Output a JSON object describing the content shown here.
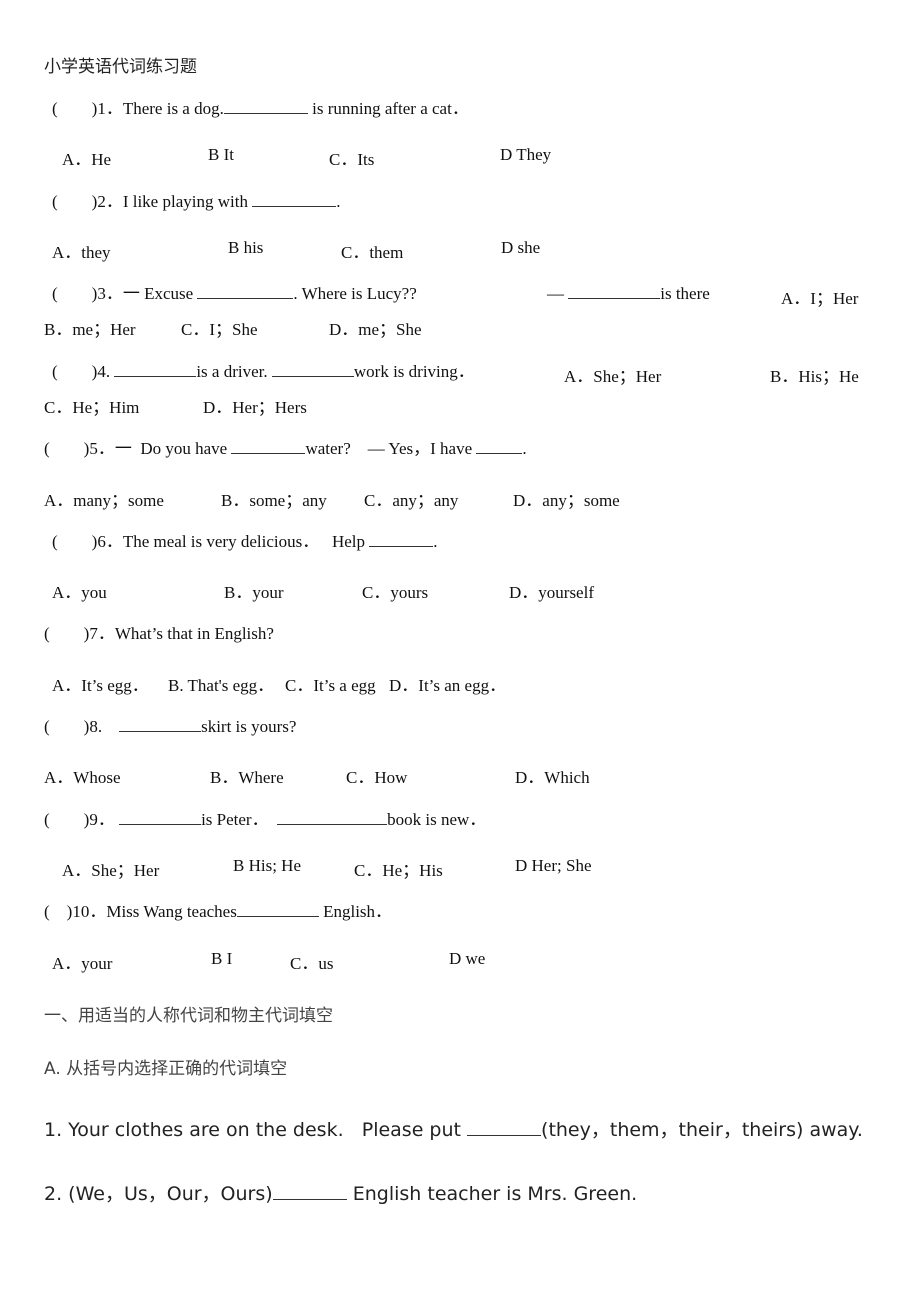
{
  "document": {
    "title": "小学英语代词练习题",
    "questions": [
      {
        "number": "1",
        "prefix": "(        )1．",
        "parts": [
          "There is a dog.",
          " is running after a cat．"
        ],
        "options": [
          "A．He",
          "B It",
          "C．Its",
          "D They"
        ]
      },
      {
        "number": "2",
        "prefix": "(        )2．",
        "parts": [
          "I like playing with ",
          "."
        ],
        "options": [
          "A．they",
          "B his",
          "C．them",
          "D she"
        ]
      },
      {
        "number": "3",
        "prefix": "(        )3．",
        "parts": [
          "一 Excuse ",
          ". Where is Lucy??",
          "— ",
          "is there"
        ],
        "options": [
          "A．I；Her",
          "B．me；Her",
          "C．I；She",
          "D．me；She"
        ]
      },
      {
        "number": "4",
        "prefix": "(        )4.",
        "parts": [
          " ",
          "is a driver. ",
          "work is driving．"
        ],
        "options": [
          "A．She；Her",
          "B．His；He",
          "C．He；Him",
          "D．Her；Hers"
        ]
      },
      {
        "number": "5",
        "prefix": "(        )5．",
        "parts": [
          "一  Do you have ",
          "water?",
          "— Yes，I have ",
          "."
        ],
        "options": [
          "A．many；some",
          "B．some；any",
          "C．any；any",
          "D．any；some"
        ]
      },
      {
        "number": "6",
        "prefix": "(        )6．",
        "parts": [
          "The meal is very delicious．   Help ",
          "."
        ],
        "options": [
          "A．you",
          "B．your",
          "C．yours",
          "D．yourself"
        ]
      },
      {
        "number": "7",
        "prefix": "(        )7．",
        "parts": [
          "What’s that in English?"
        ],
        "options": [
          "A．It’s egg．",
          "B. That's egg．",
          "C．It’s a egg",
          "D．It’s an egg．"
        ]
      },
      {
        "number": "8",
        "prefix": "(        )8.",
        "parts": [
          "skirt is yours?"
        ],
        "options": [
          "A．Whose",
          "B．Where",
          "C．How",
          "D．Which"
        ]
      },
      {
        "number": "9",
        "prefix": "(        )9．",
        "parts": [
          "is Peter．",
          "book is new．"
        ],
        "options": [
          "A．She；Her",
          "B His; He",
          "C．He；His",
          "D Her; She"
        ]
      },
      {
        "number": "10",
        "prefix": "(    )10．",
        "parts": [
          "Miss Wang teaches",
          " English．"
        ],
        "options": [
          "A．your",
          "B I",
          "C．us",
          "D we"
        ]
      }
    ],
    "section_heading": "一、用适当的人称代词和物主代词填空",
    "subsection_heading": "A. 从括号内选择正确的代词填空",
    "fill_in": [
      {
        "parts": [
          "1. Your clothes are on the desk.   Please put ",
          "(they，them，their，theirs) away."
        ]
      },
      {
        "parts": [
          "2. (We，Us，Our，Ours)",
          " English teacher is Mrs. Green."
        ]
      }
    ]
  }
}
